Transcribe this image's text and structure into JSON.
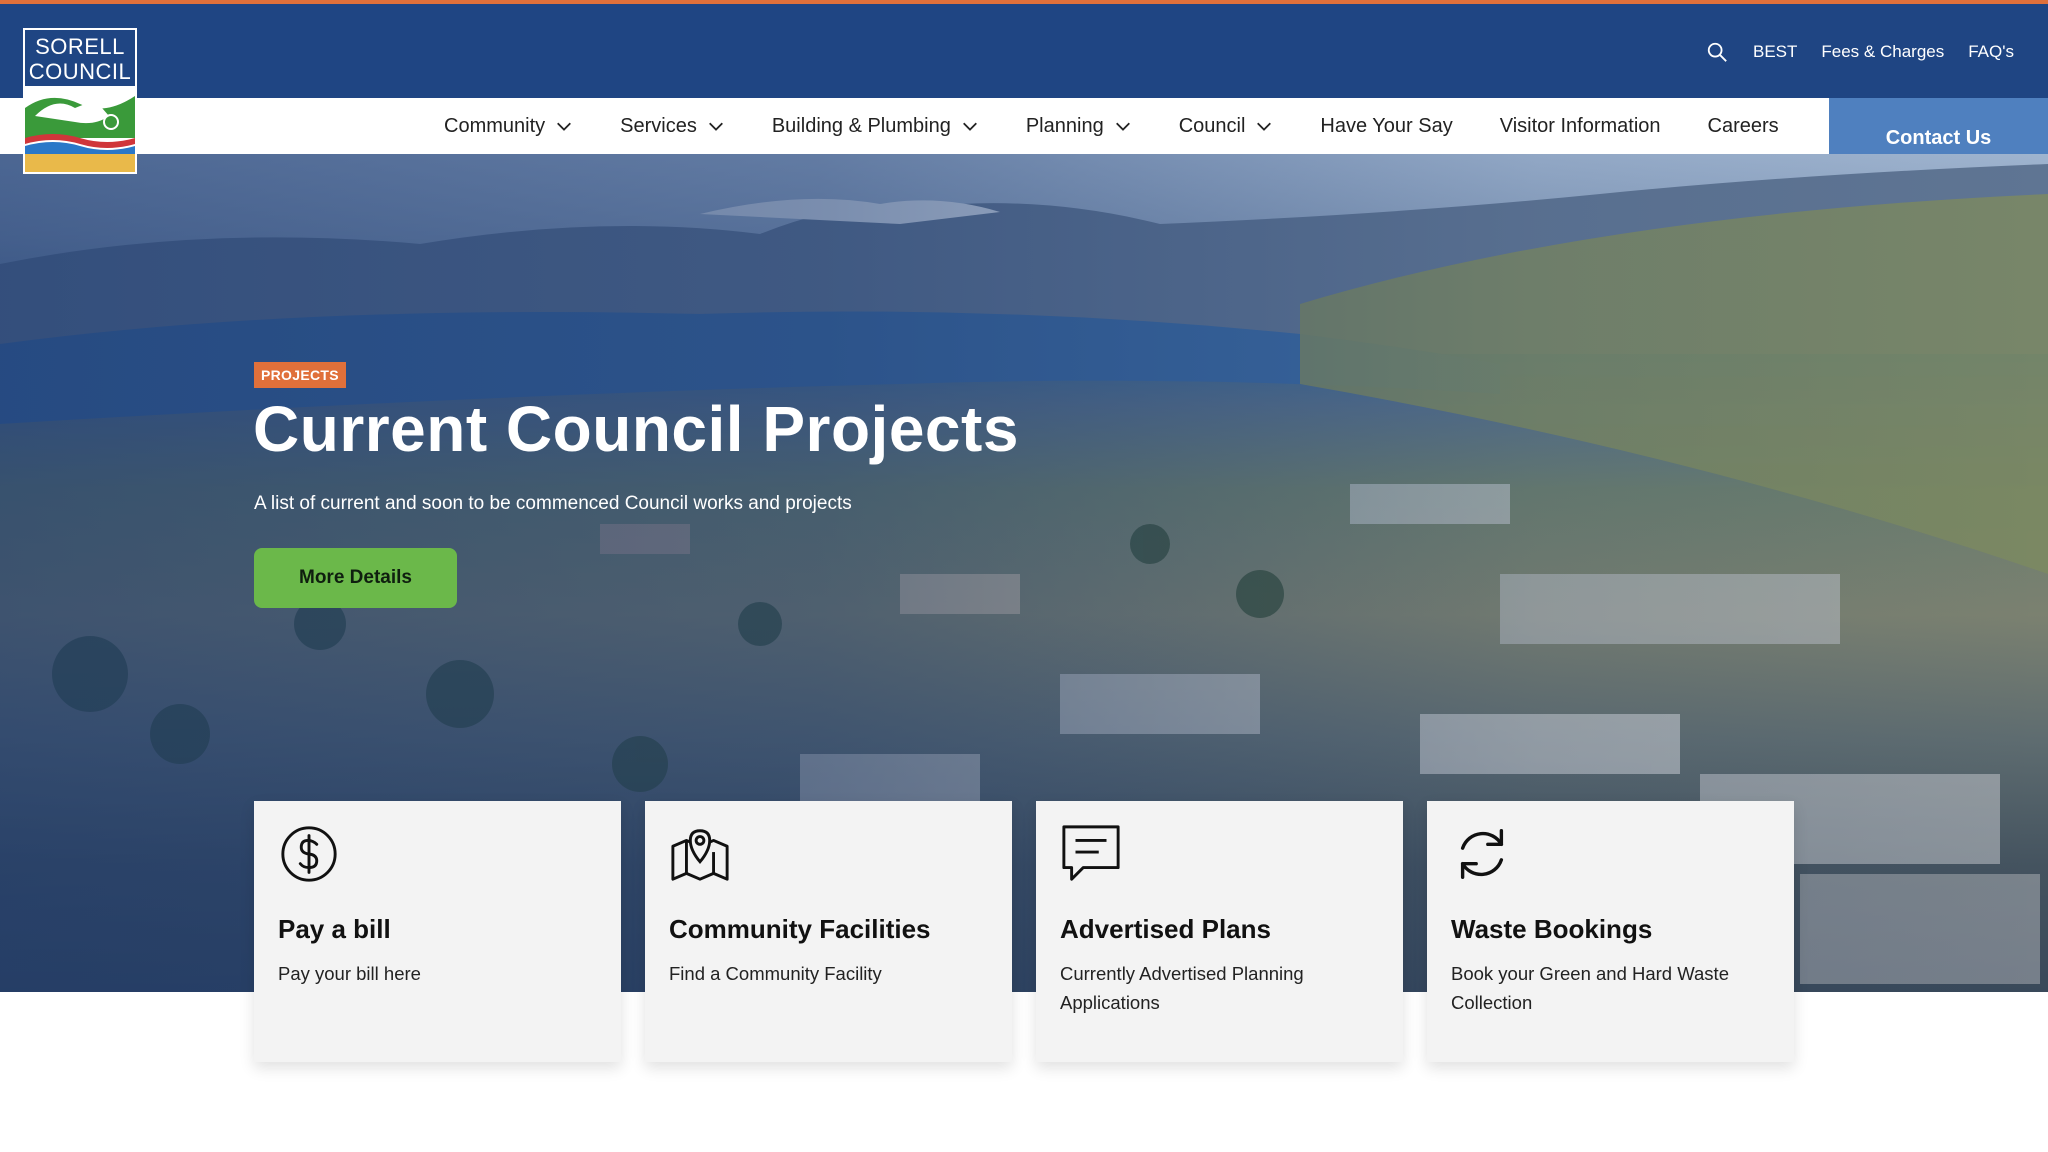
{
  "logo": {
    "line1": "SORELL",
    "line2": "COUNCIL"
  },
  "utility": {
    "links": [
      "BEST",
      "Fees & Charges",
      "FAQ's"
    ]
  },
  "nav": {
    "items": [
      {
        "label": "Community"
      },
      {
        "label": "Services"
      },
      {
        "label": "Building & Plumbing"
      },
      {
        "label": "Planning"
      },
      {
        "label": "Council"
      },
      {
        "label": "Have Your Say"
      },
      {
        "label": "Visitor Information"
      },
      {
        "label": "Careers"
      }
    ],
    "contact": "Contact Us"
  },
  "hero": {
    "badge": "PROJECTS",
    "title": "Current Council Projects",
    "subtitle": "A list of current and soon to be commenced Council works and projects",
    "button": "More Details"
  },
  "cards": [
    {
      "icon": "dollar-icon",
      "title": "Pay a bill",
      "text": "Pay your bill here"
    },
    {
      "icon": "map-icon",
      "title": "Community Facilities",
      "text": "Find a Community Facility"
    },
    {
      "icon": "chat-icon",
      "title": "Advertised Plans",
      "text": "Currently Advertised Planning Applications"
    },
    {
      "icon": "refresh-icon",
      "title": "Waste Bookings",
      "text": "Book your Green and Hard Waste Collection"
    }
  ],
  "colors": {
    "navy": "#1f4583",
    "orange": "#e0703a",
    "green": "#6bb84a",
    "contact_blue": "#4f80bf"
  }
}
